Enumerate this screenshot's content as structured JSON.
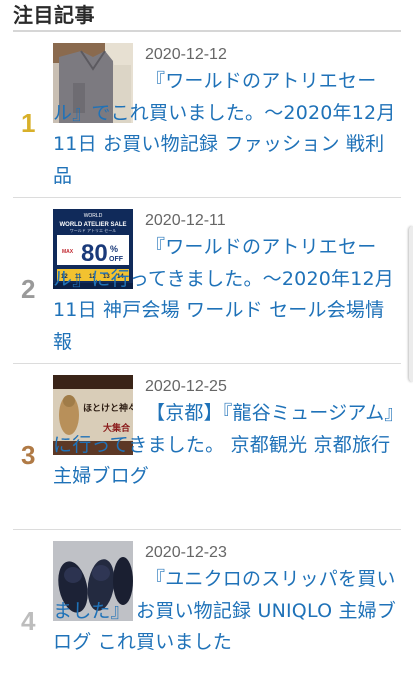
{
  "section": {
    "heading": "注目記事"
  },
  "articles": [
    {
      "rank": "1",
      "rank_color": "#d8b02a",
      "date": "2020-12-12",
      "title": "『ワールドのアトリエセール』でこれ買いました。～2020年12月11日 お買い物記録 ファッション 戦利品",
      "thumbnail": "clothing-sweater-photo"
    },
    {
      "rank": "2",
      "rank_color": "#9a9a9a",
      "date": "2020-12-11",
      "title": "『ワールドのアトリエセール』に行ってきました。～2020年12月11日 神戸会場 ワールド セール会場情報",
      "thumbnail": "sale-poster-photo",
      "thumbnail_text": {
        "brand": "WORLD",
        "headline": "WORLD ATELIER SALE",
        "sub": "ワールド アトリエ セール",
        "max": "MAX",
        "percent": "80",
        "pct_sign": "%",
        "off": "OFF",
        "dates": [
          "12",
          "11",
          "12",
          "13",
          "14"
        ]
      }
    },
    {
      "rank": "3",
      "rank_color": "#b07a45",
      "date": "2020-12-25",
      "title": "【京都】『龍谷ミュージアム』に行ってきました。 京都観光 京都旅行 主婦ブログ",
      "thumbnail": "museum-banner-photo",
      "thumbnail_text": {
        "banner": "ほとけと神々",
        "banner2": "大集合"
      }
    },
    {
      "rank": "4",
      "rank_color": "#bdbdbd",
      "date": "2020-12-23",
      "title": "『ユニクロのスリッパを買いました』 お買い物記録 UNIQLO 主婦ブログ これ買いました",
      "thumbnail": "slippers-photo"
    }
  ]
}
